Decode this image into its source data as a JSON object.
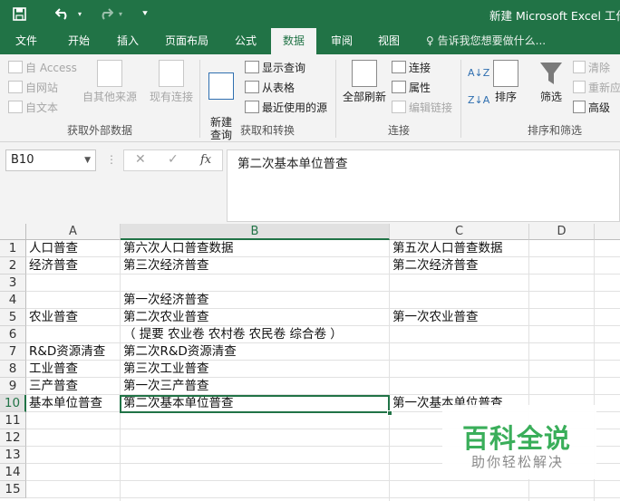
{
  "titlebar": {
    "title": "新建 Microsoft Excel 工作",
    "save_icon": "save-icon",
    "undo_icon": "undo-icon",
    "redo_icon": "redo-icon",
    "customize_icon": "customize-icon"
  },
  "tabs": [
    {
      "label": "文件",
      "active": false
    },
    {
      "label": "开始",
      "active": false
    },
    {
      "label": "插入",
      "active": false
    },
    {
      "label": "页面布局",
      "active": false
    },
    {
      "label": "公式",
      "active": false
    },
    {
      "label": "数据",
      "active": true
    },
    {
      "label": "审阅",
      "active": false
    },
    {
      "label": "视图",
      "active": false
    }
  ],
  "tell_me": "告诉我您想要做什么...",
  "ribbon": {
    "get_external": {
      "label": "获取外部数据",
      "access": "自 Access",
      "web": "自网站",
      "text": "自文本",
      "other": "自其他来源",
      "existing": "现有连接"
    },
    "get_transform": {
      "label": "获取和转换",
      "new_query": "新建\n查询",
      "show_queries": "显示查询",
      "from_table": "从表格",
      "recent_sources": "最近使用的源"
    },
    "connections": {
      "label": "连接",
      "refresh_all": "全部刷新",
      "connections": "连接",
      "properties": "属性",
      "edit_links": "编辑链接"
    },
    "sort_filter": {
      "label": "排序和筛选",
      "sort": "排序",
      "filter": "筛选",
      "clear": "清除",
      "reapply": "重新应",
      "advanced": "高级"
    }
  },
  "formula_bar": {
    "name_box": "B10",
    "formula": "第二次基本单位普查"
  },
  "columns": [
    "A",
    "B",
    "C",
    "D"
  ],
  "selected_column": "B",
  "rows": [
    "1",
    "2",
    "3",
    "4",
    "5",
    "6",
    "7",
    "8",
    "9",
    "10",
    "11",
    "12",
    "13",
    "14",
    "15"
  ],
  "selected_row": "10",
  "cells": {
    "A1": "人口普查",
    "B1": "第六次人口普查数据",
    "C1": "第五次人口普查数据",
    "A2": "经济普查",
    "B2": "第三次经济普查",
    "C2": "第二次经济普查",
    "B4": "第一次经济普查",
    "A5": "农业普查",
    "B5": "第二次农业普查",
    "C5": "第一次农业普查",
    "B6": "（ 提要 农业卷 农村卷 农民卷 综合卷 ）",
    "A7": "R&D资源清查",
    "B7": "第二次R&D资源清查",
    "A8": "工业普查",
    "B8": "第三次工业普查",
    "A9": "三产普查",
    "B9": "第一次三产普查",
    "A10": "基本单位普查",
    "B10": "第二次基本单位普查",
    "C10": "第一次基本单位普查"
  },
  "watermark": {
    "main": "百科全说",
    "sub": "助你轻松解决"
  }
}
